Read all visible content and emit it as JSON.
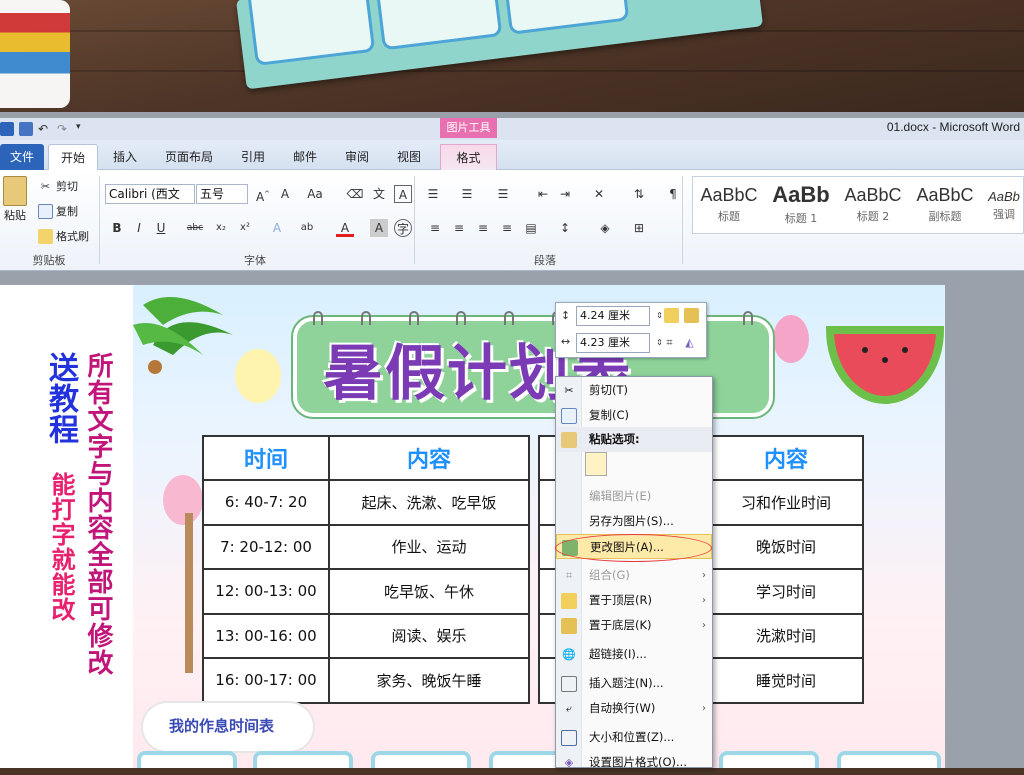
{
  "window": {
    "title": "01.docx  -  Microsoft Word"
  },
  "contextual_tab_group": "图片工具",
  "tabs": [
    {
      "label": "文件"
    },
    {
      "label": "开始"
    },
    {
      "label": "插入"
    },
    {
      "label": "页面布局"
    },
    {
      "label": "引用"
    },
    {
      "label": "邮件"
    },
    {
      "label": "审阅"
    },
    {
      "label": "视图"
    },
    {
      "label": "格式"
    }
  ],
  "ribbon": {
    "clipboard": {
      "paste": "粘贴",
      "cut": "剪切",
      "copy": "复制",
      "format_painter": "格式刷",
      "group": "剪贴板"
    },
    "font": {
      "name": "Calibri (西文",
      ".size": "",
      "size": "五号",
      "group": "字体",
      "text_color": "#e02020"
    },
    "paragraph": {
      "group": "段落"
    },
    "styles": [
      {
        "sample": "AaBbC",
        "name": "标题"
      },
      {
        "sample": "AaBb",
        "name": "标题 1"
      },
      {
        "sample": "AaBbC",
        "name": "标题 2"
      },
      {
        "sample": "AaBbC",
        "name": "副标题"
      },
      {
        "sample": "AaBb",
        "name": "强调"
      }
    ]
  },
  "size_toolbar": {
    "height": "4.24 厘米",
    "width": "4.23 厘米"
  },
  "context_menu": {
    "items": [
      {
        "label": "剪切(T)",
        "icon": "scissors-icon",
        "enabled": true
      },
      {
        "label": "复制(C)",
        "icon": "copy-icon",
        "enabled": true
      },
      {
        "label": "粘贴选项:",
        "icon": "paste-icon",
        "enabled": true
      },
      {
        "label": "编辑图片(E)",
        "icon": "",
        "enabled": false
      },
      {
        "label": "另存为图片(S)...",
        "icon": "",
        "enabled": true
      },
      {
        "label": "更改图片(A)...",
        "icon": "change-picture-icon",
        "enabled": true
      },
      {
        "label": "组合(G)",
        "icon": "group-icon",
        "enabled": false
      },
      {
        "label": "置于顶层(R)",
        "icon": "bring-front-icon",
        "enabled": true
      },
      {
        "label": "置于底层(K)",
        "icon": "send-back-icon",
        "enabled": true
      },
      {
        "label": "超链接(I)...",
        "icon": "hyperlink-icon",
        "enabled": true
      },
      {
        "label": "插入题注(N)...",
        "icon": "caption-icon",
        "enabled": true
      },
      {
        "label": "自动换行(W)",
        "icon": "wrap-icon",
        "enabled": true
      },
      {
        "label": "大小和位置(Z)...",
        "icon": "size-icon",
        "enabled": true
      },
      {
        "label": "设置图片格式(O)...",
        "icon": "format-picture-icon",
        "enabled": true
      }
    ]
  },
  "poster": {
    "title": "暑假计划表",
    "left_table": {
      "headers": [
        "时间",
        "内容"
      ],
      "rows": [
        [
          "6: 40-7: 20",
          "起床、洗漱、吃早饭"
        ],
        [
          "7: 20-12: 00",
          "作业、运动"
        ],
        [
          "12: 00-13: 00",
          "吃早饭、午休"
        ],
        [
          "13: 00-16: 00",
          "阅读、娱乐"
        ],
        [
          "16: 00-17: 00",
          "家务、晚饭午睡"
        ]
      ]
    },
    "right_table": {
      "header": "内容",
      "rows": [
        "习和作业时间",
        "晚饭时间",
        "学习时间",
        "洗漱时间",
        "睡觉时间"
      ]
    },
    "caption": "我的作息时间表"
  },
  "promo": {
    "col1": "送教程",
    "col1b": "能打字就能改",
    "col2": "所有文字与内容全部可修改"
  }
}
